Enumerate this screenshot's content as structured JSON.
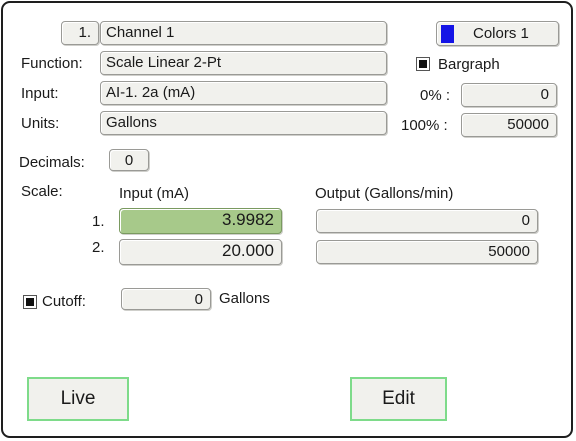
{
  "header": {
    "channel_number": "1.",
    "channel_name": "Channel 1",
    "colors_label": "Colors 1",
    "colors_swatch": "#1414e6"
  },
  "function": {
    "label": "Function:",
    "value": "Scale Linear 2-Pt"
  },
  "input": {
    "label": "Input:",
    "value": "AI-1. 2a (mA)"
  },
  "units": {
    "label": "Units:",
    "value": "Gallons"
  },
  "bargraph": {
    "label": "Bargraph",
    "checked": true
  },
  "range": {
    "zero_label": "0% :",
    "zero_value": "0",
    "full_label": "100% :",
    "full_value": "50000"
  },
  "decimals": {
    "label": "Decimals:",
    "value": "0"
  },
  "scale": {
    "label": "Scale:",
    "input_header": "Input (mA)",
    "output_header": "Output (Gallons/min)",
    "rows": [
      {
        "index": "1.",
        "input": "3.9982",
        "output": "0"
      },
      {
        "index": "2.",
        "input": "20.000",
        "output": "50000"
      }
    ]
  },
  "cutoff": {
    "label": "Cutoff:",
    "checked": true,
    "value": "0",
    "unit": "Gallons"
  },
  "buttons": {
    "live": "Live",
    "edit": "Edit"
  }
}
